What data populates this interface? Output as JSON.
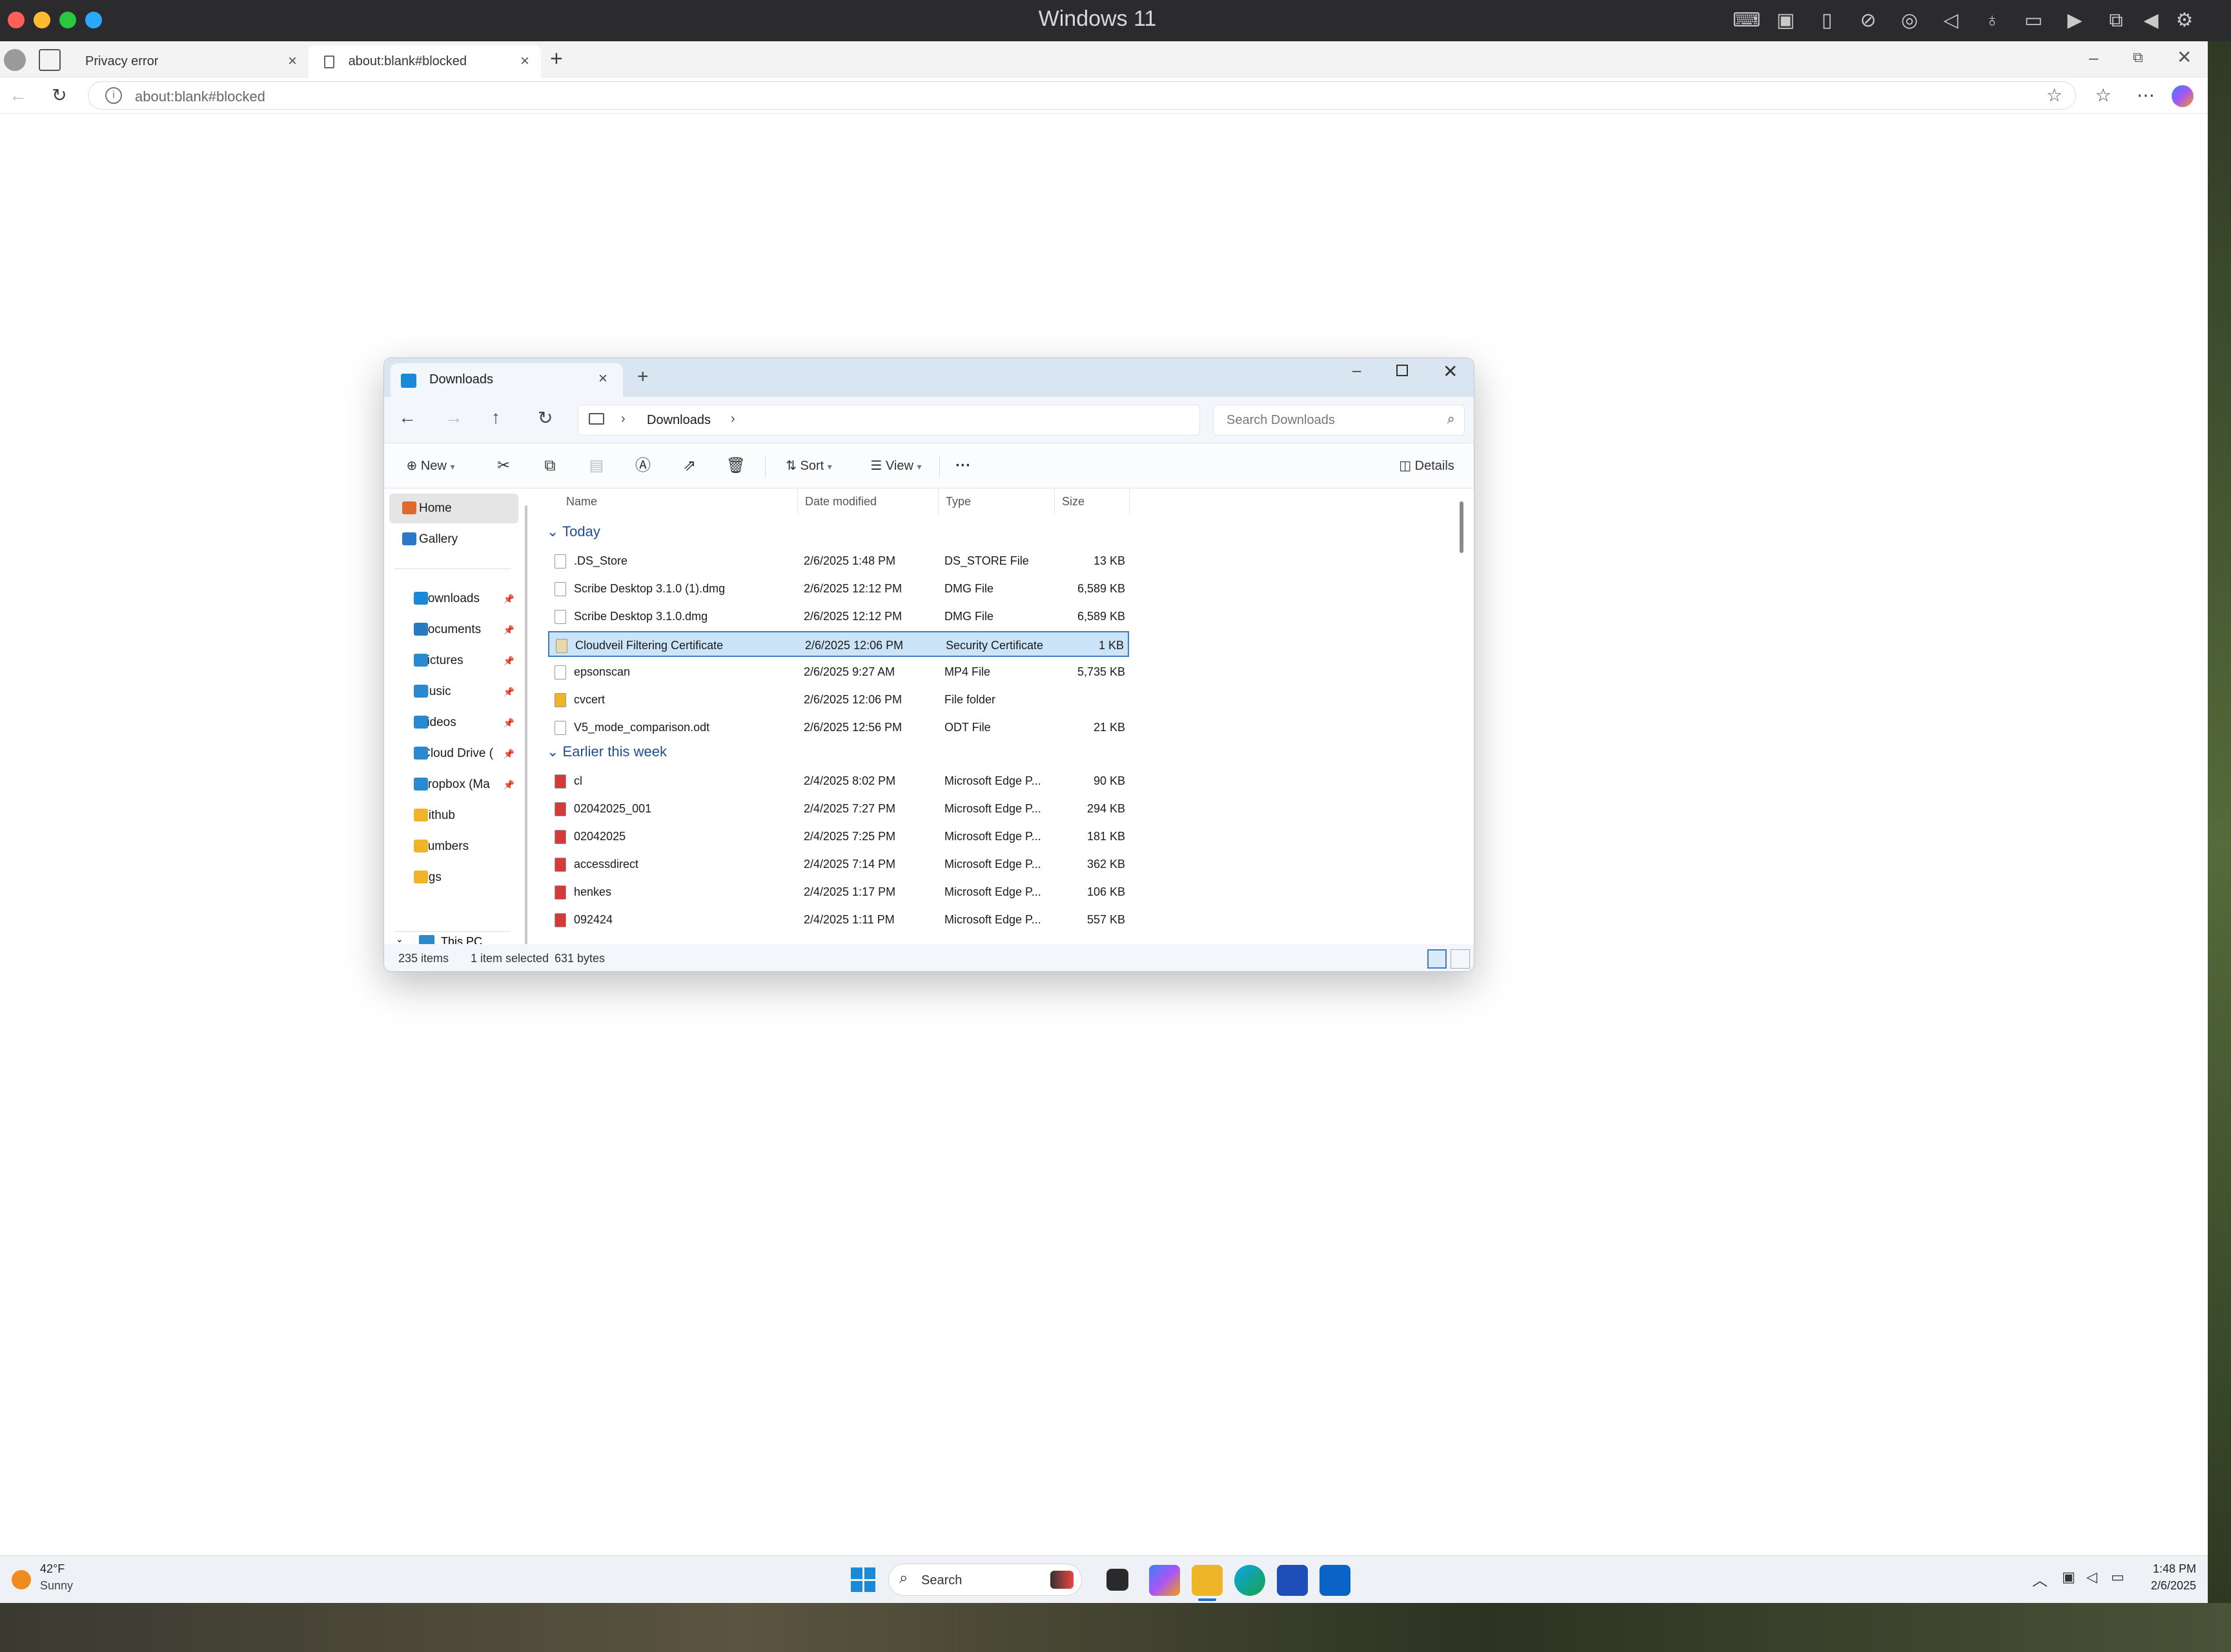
{
  "host": {
    "title": "Windows 11",
    "traffic_colors": [
      "#fe5f57",
      "#febc2e",
      "#28c840",
      "#2aa9ff"
    ],
    "tray_icons": [
      "keyboard-icon",
      "cpu-icon",
      "usb-icon",
      "no-camera-icon",
      "globe-icon",
      "speaker-icon",
      "microphone-icon",
      "disk-icon",
      "video-camera-icon",
      "screen-share-icon",
      "back-triangle-icon",
      "gear-icon"
    ]
  },
  "browser": {
    "tabs": [
      {
        "label": "Privacy error"
      },
      {
        "label": "about:blank#blocked"
      }
    ],
    "address": "about:blank#blocked"
  },
  "explorer": {
    "tab_title": "Downloads",
    "breadcrumb": [
      "Downloads"
    ],
    "search_placeholder": "Search Downloads",
    "toolbar": {
      "new_label": "New",
      "sort_label": "Sort",
      "view_label": "View",
      "details_label": "Details",
      "more_label": "···"
    },
    "nav": {
      "top": [
        {
          "label": "Home",
          "color": "#e06a2c"
        },
        {
          "label": "Gallery",
          "color": "#2a78c8"
        }
      ],
      "pinned": [
        {
          "label": "Downloads",
          "color": "#1a8ad8"
        },
        {
          "label": "Documents",
          "color": "#2a7ac0"
        },
        {
          "label": "Pictures",
          "color": "#2a8ad0"
        },
        {
          "label": "Music",
          "color": "#2a8ad0"
        },
        {
          "label": "Videos",
          "color": "#2a8ad0"
        },
        {
          "label": "iCloud Drive (",
          "color": "#2a8ad0"
        },
        {
          "label": "Dropbox (Ma",
          "color": "#2a8ad0"
        },
        {
          "label": "Github",
          "color": "#f0b429"
        },
        {
          "label": "Numbers",
          "color": "#f0b429"
        },
        {
          "label": "logs",
          "color": "#f0b429"
        }
      ],
      "this_pc": "This PC"
    },
    "columns": {
      "name": "Name",
      "date": "Date modified",
      "type": "Type",
      "size": "Size"
    },
    "groups": [
      {
        "label": "Today",
        "files": [
          {
            "name": ".DS_Store",
            "date": "2/6/2025 1:48 PM",
            "type": "DS_STORE File",
            "size": "13 KB",
            "icon": "file-icon"
          },
          {
            "name": "Scribe Desktop 3.1.0 (1).dmg",
            "date": "2/6/2025 12:12 PM",
            "type": "DMG File",
            "size": "6,589 KB",
            "icon": "file-icon"
          },
          {
            "name": "Scribe Desktop 3.1.0.dmg",
            "date": "2/6/2025 12:12 PM",
            "type": "DMG File",
            "size": "6,589 KB",
            "icon": "file-icon"
          },
          {
            "name": "Cloudveil Filtering Certificate",
            "date": "2/6/2025 12:06 PM",
            "type": "Security Certificate",
            "size": "1 KB",
            "icon": "certificate-icon",
            "selected": true
          },
          {
            "name": "epsonscan",
            "date": "2/6/2025 9:27 AM",
            "type": "MP4 File",
            "size": "5,735 KB",
            "icon": "video-file-icon"
          },
          {
            "name": "cvcert",
            "date": "2/6/2025 12:06 PM",
            "type": "File folder",
            "size": "",
            "icon": "folder-icon"
          },
          {
            "name": "V5_mode_comparison.odt",
            "date": "2/6/2025 12:56 PM",
            "type": "ODT File",
            "size": "21 KB",
            "icon": "file-icon"
          }
        ]
      },
      {
        "label": "Earlier this week",
        "files": [
          {
            "name": "cl",
            "date": "2/4/2025 8:02 PM",
            "type": "Microsoft Edge P...",
            "size": "90 KB",
            "icon": "pdf-icon"
          },
          {
            "name": "02042025_001",
            "date": "2/4/2025 7:27 PM",
            "type": "Microsoft Edge P...",
            "size": "294 KB",
            "icon": "pdf-icon"
          },
          {
            "name": "02042025",
            "date": "2/4/2025 7:25 PM",
            "type": "Microsoft Edge P...",
            "size": "181 KB",
            "icon": "pdf-icon"
          },
          {
            "name": "accessdirect",
            "date": "2/4/2025 7:14 PM",
            "type": "Microsoft Edge P...",
            "size": "362 KB",
            "icon": "pdf-icon"
          },
          {
            "name": "henkes",
            "date": "2/4/2025 1:17 PM",
            "type": "Microsoft Edge P...",
            "size": "106 KB",
            "icon": "pdf-icon"
          },
          {
            "name": "092424",
            "date": "2/4/2025 1:11 PM",
            "type": "Microsoft Edge P...",
            "size": "557 KB",
            "icon": "pdf-icon"
          }
        ]
      }
    ],
    "status": {
      "count": "235 items",
      "selected": "1 item selected",
      "bytes": "631 bytes"
    }
  },
  "taskbar": {
    "weather_temp": "42°F",
    "weather_cond": "Sunny",
    "search_label": "Search",
    "time": "1:48 PM",
    "date": "2/6/2025"
  }
}
